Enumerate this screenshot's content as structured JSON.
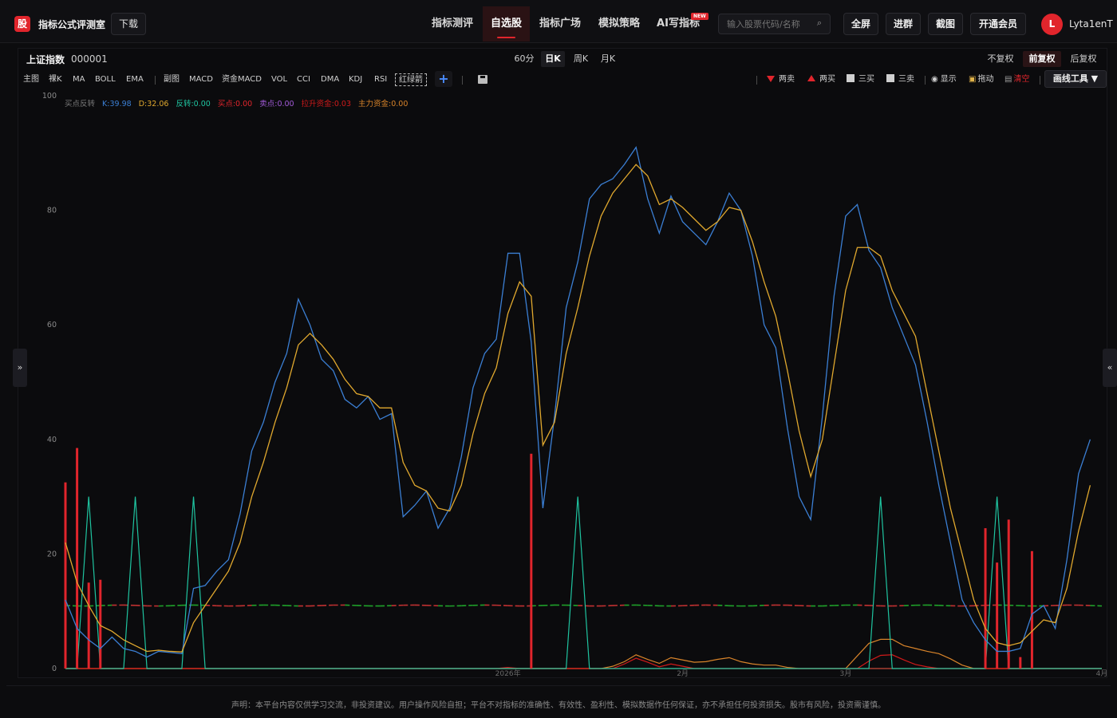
{
  "header": {
    "logo_char": "股",
    "app_title": "指标公式评测室",
    "download": "下载",
    "nav": [
      "指标测评",
      "自选股",
      "指标广场",
      "模拟策略",
      "AI写指标"
    ],
    "nav_active": 1,
    "new_badge": "NEW",
    "search_placeholder": "输入股票代码/名称",
    "buttons": [
      "全屏",
      "进群",
      "截图",
      "开通会员"
    ],
    "avatar_letter": "L",
    "username": "Lyta1enT"
  },
  "stock": {
    "name": "上证指数",
    "code": "000001",
    "periods": [
      "60分",
      "日K",
      "周K",
      "月K"
    ],
    "period_active": 1,
    "adjust": [
      "不复权",
      "前复权",
      "后复权"
    ],
    "adjust_active": 1
  },
  "toolbar": {
    "main_label": "主图",
    "main_items": [
      "裸K",
      "MA",
      "BOLL",
      "EMA"
    ],
    "sub_label": "副图",
    "sub_items": [
      "MACD",
      "资金MACD",
      "VOL",
      "CCI",
      "DMA",
      "KDJ",
      "RSI",
      "红绿箭"
    ],
    "sub_boxed": "红绿箭",
    "plus": "+",
    "tools": [
      "两卖",
      "两买",
      "三买",
      "三卖",
      "显示",
      "拖动",
      "清空"
    ],
    "draw_tools": "画线工具 ▼",
    "side_left": "»",
    "side_right": "«"
  },
  "legend": {
    "name": "买点反转",
    "items": [
      {
        "label": "K:39.98",
        "color": "#3b7fd4"
      },
      {
        "label": "D:32.06",
        "color": "#e0a82e"
      },
      {
        "label": "反转:0.00",
        "color": "#1fc4a0"
      },
      {
        "label": "买点:0.00",
        "color": "#e1252c"
      },
      {
        "label": "卖点:0.00",
        "color": "#a25ad8"
      },
      {
        "label": "拉升资金:0.03",
        "color": "#d01a1a"
      },
      {
        "label": "主力资金:0.00",
        "color": "#d9842a"
      }
    ]
  },
  "chart_data": {
    "type": "line",
    "ylim": [
      0,
      100
    ],
    "y_ticks": [
      0,
      20,
      40,
      60,
      80,
      100
    ],
    "x_labels": [
      {
        "text": "2026年",
        "index": 38
      },
      {
        "text": "2月",
        "index": 53
      },
      {
        "text": "3月",
        "index": 67
      },
      {
        "text": "4月",
        "index": 89
      }
    ],
    "n": 90,
    "series": [
      {
        "name": "K",
        "color": "#3b7fd4",
        "values": [
          12,
          7,
          5,
          3.5,
          5.5,
          3.5,
          3,
          2,
          3,
          2.8,
          2.6,
          14,
          14.5,
          17,
          19,
          27,
          38,
          43,
          50,
          55,
          64.5,
          60,
          54,
          52,
          47,
          45.5,
          47.5,
          43.5,
          44.5,
          26.5,
          28.5,
          31,
          24.5,
          28,
          37,
          49,
          55,
          57.5,
          72.5,
          72.5,
          57,
          28,
          44,
          63,
          71,
          82,
          84.5,
          85.5,
          88,
          91,
          82,
          76,
          82.5,
          78,
          76,
          74,
          78,
          83,
          80,
          72,
          60,
          56,
          42,
          30,
          26,
          44,
          65,
          79,
          81,
          73,
          70,
          63,
          58,
          53,
          43,
          32,
          22,
          12,
          8,
          5,
          3,
          3,
          3.5,
          9.5,
          11,
          7,
          19,
          34,
          40
        ]
      },
      {
        "name": "D",
        "color": "#e0a82e",
        "values": [
          22,
          15,
          11,
          7.5,
          6.5,
          5,
          4,
          3,
          3.2,
          3,
          2.9,
          8,
          11,
          14,
          17,
          22,
          30,
          36,
          43,
          49,
          56.5,
          58.5,
          56.5,
          54,
          50.5,
          48,
          47.5,
          45.5,
          45.5,
          36,
          32,
          31,
          28,
          27.5,
          32,
          41,
          48,
          52.5,
          62,
          67.5,
          65,
          39,
          43,
          55,
          63,
          72,
          79,
          83,
          85.5,
          88,
          86,
          81,
          82,
          80.5,
          78.5,
          76.5,
          78,
          80.5,
          80,
          74.5,
          67.5,
          61.5,
          52,
          41.5,
          33.5,
          40,
          53,
          66,
          73.5,
          73.5,
          72,
          66,
          62,
          58,
          48,
          38,
          28,
          20,
          12,
          7,
          4.5,
          4,
          4.5,
          6.5,
          8.5,
          8,
          14,
          24,
          32
        ]
      }
    ],
    "signal_lines": [
      {
        "name": "反转",
        "color": "#1fc4a0",
        "values": {
          "2": 30,
          "6": 30,
          "11": 30,
          "44": 30,
          "70": 30,
          "80": 30
        }
      },
      {
        "name": "买点",
        "color": "#e1252c",
        "bars": {
          "0": 32.5,
          "1": 38.5,
          "2": 15,
          "3": 15.5,
          "40": 37.5,
          "79": 24.5,
          "80": 18.5,
          "81": 26,
          "82": 2,
          "83": 20.5
        }
      },
      {
        "name": "主力资金",
        "color": "#d9842a",
        "values": {
          "47": 0.4,
          "48": 1.2,
          "49": 2.4,
          "50": 1.6,
          "51": 0.9,
          "52": 1.9,
          "53": 1.5,
          "54": 1.1,
          "55": 1.2,
          "56": 1.6,
          "57": 1.9,
          "58": 1.2,
          "59": 0.8,
          "60": 0.6,
          "61": 0.6,
          "62": 0.2,
          "68": 2.2,
          "69": 4.4,
          "70": 5.1,
          "71": 5.1,
          "72": 4,
          "73": 3.5,
          "74": 3,
          "75": 2.6,
          "76": 1.7,
          "77": 0.6
        }
      },
      {
        "name": "拉升资金",
        "color": "#d01a1a",
        "values": {
          "38": 0.2,
          "48": 0.8,
          "49": 1.8,
          "50": 1.1,
          "51": 0.3,
          "52": 0.8,
          "53": 0.4,
          "69": 1.3,
          "70": 2.3,
          "71": 2.4,
          "72": 1.5,
          "73": 0.7,
          "74": 0.3
        }
      }
    ],
    "dashed_level": {
      "value": 11,
      "colors": [
        "#1fa32a",
        "#c23131"
      ]
    }
  },
  "footer": {
    "disclaimer": "声明：本平台内容仅供学习交流，非投资建议。用户操作风险自担；平台不对指标的准确性、有效性、盈利性、模拟数据作任何保证，亦不承担任何投资损失。股市有风险，投资需谨慎。"
  }
}
